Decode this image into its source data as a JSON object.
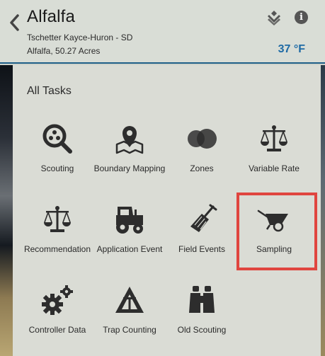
{
  "header": {
    "title": "Alfalfa",
    "subtitle_line1": "Tschetter Kayce-Huron - SD",
    "subtitle_line2": "Alfalfa, 50.27 Acres",
    "temperature": "37 °F",
    "info_label": "i"
  },
  "panel": {
    "title": "All Tasks",
    "tasks": [
      {
        "label": "Scouting",
        "icon": "magnifier-icon"
      },
      {
        "label": "Boundary Mapping",
        "icon": "map-pin-icon"
      },
      {
        "label": "Zones",
        "icon": "zones-circles-icon"
      },
      {
        "label": "Variable Rate",
        "icon": "scale-icon"
      },
      {
        "label": "Recommendation",
        "icon": "scale-icon"
      },
      {
        "label": "Application Event",
        "icon": "tractor-icon"
      },
      {
        "label": "Field Events",
        "icon": "shovel-icon"
      },
      {
        "label": "Sampling",
        "icon": "wheelbarrow-icon",
        "selected": true
      },
      {
        "label": "Controller Data",
        "icon": "gears-icon"
      },
      {
        "label": "Trap Counting",
        "icon": "trap-triangle-icon"
      },
      {
        "label": "Old Scouting",
        "icon": "binoculars-icon"
      }
    ]
  },
  "colors": {
    "accent_blue": "#1e6aa5",
    "selection_red": "#e0453f",
    "panel_bg": "#dadcd5"
  }
}
